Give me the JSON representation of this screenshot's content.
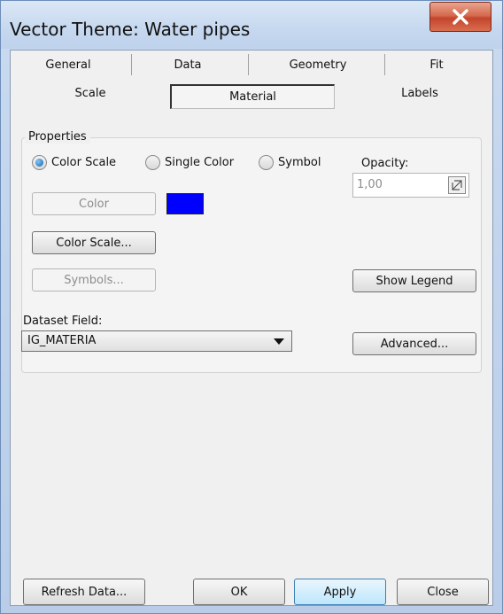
{
  "window": {
    "title": "Vector Theme: Water pipes"
  },
  "tabs": {
    "row1": [
      "General",
      "Data",
      "Geometry",
      "Fit"
    ],
    "row2": [
      "Scale",
      "Material",
      "Labels"
    ],
    "active": "Material"
  },
  "properties": {
    "group_label": "Properties",
    "radios": [
      {
        "label": "Color Scale",
        "checked": true
      },
      {
        "label": "Single Color",
        "checked": false
      },
      {
        "label": "Symbol",
        "checked": false
      }
    ],
    "opacity_label": "Opacity:",
    "opacity_value": "1,00",
    "color_button": "Color",
    "color_swatch": "#0000ff",
    "color_scale_button": "Color Scale...",
    "symbols_button": "Symbols...",
    "show_legend_button": "Show Legend",
    "dataset_field_label": "Dataset Field:",
    "dataset_field_value": "IG_MATERIA",
    "advanced_button": "Advanced..."
  },
  "footer": {
    "refresh": "Refresh Data...",
    "ok": "OK",
    "apply": "Apply",
    "close": "Close"
  }
}
